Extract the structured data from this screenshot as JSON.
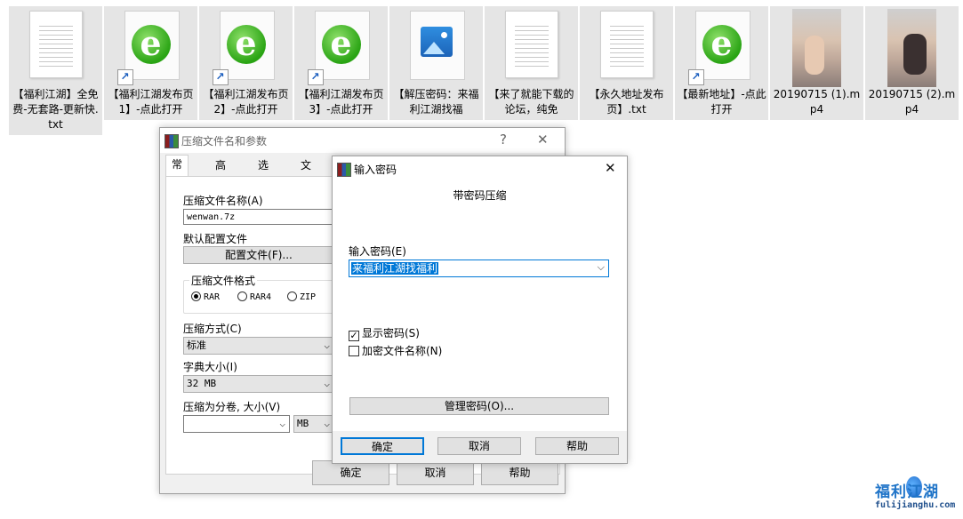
{
  "desktop": {
    "files": [
      {
        "label": "【福利江湖】全免费-无套路-更新快.txt",
        "kind": "text"
      },
      {
        "label": "【福利江湖发布页1】-点此打开",
        "kind": "ie-shortcut"
      },
      {
        "label": "【福利江湖发布页2】-点此打开",
        "kind": "ie-shortcut"
      },
      {
        "label": "【福利江湖发布页3】-点此打开",
        "kind": "ie-shortcut"
      },
      {
        "label": "【解压密码：来福利江湖找福",
        "kind": "image"
      },
      {
        "label": "【来了就能下载的论坛，纯免",
        "kind": "text"
      },
      {
        "label": "【永久地址发布页】.txt",
        "kind": "text"
      },
      {
        "label": "【最新地址】-点此打开",
        "kind": "ie-shortcut"
      },
      {
        "label": "20190715 (1).mp4",
        "kind": "video"
      },
      {
        "label": "20190715 (2).mp4",
        "kind": "video"
      }
    ]
  },
  "archive_dialog": {
    "title": "压缩文件名和参数",
    "help_glyph": "?",
    "close_glyph": "✕",
    "tabs": [
      "常规",
      "高级",
      "选项",
      "文件"
    ],
    "archive_name_label": "压缩文件名称(A)",
    "archive_name_value": "wenwan.7z",
    "default_profile_label": "默认配置文件",
    "profile_button": "配置文件(F)...",
    "format_group_label": "压缩文件格式",
    "formats": [
      "RAR",
      "RAR4",
      "ZIP"
    ],
    "selected_format": "RAR",
    "method_label": "压缩方式(C)",
    "method_value": "标准",
    "dict_label": "字典大小(I)",
    "dict_value": "32 MB",
    "split_label": "压缩为分卷, 大小(V)",
    "split_value": "",
    "split_unit": "MB",
    "ok": "确定",
    "cancel": "取消",
    "help": "帮助"
  },
  "password_dialog": {
    "title": "输入密码",
    "close_glyph": "✕",
    "heading": "带密码压缩",
    "input_label": "输入密码(E)",
    "password_value": "来福利江湖找福利",
    "show_password_label": "显示密码(S)",
    "show_password_checked": true,
    "encrypt_names_label": "加密文件名称(N)",
    "encrypt_names_checked": false,
    "manage_button": "管理密码(O)...",
    "ok": "确定",
    "cancel": "取消",
    "help": "帮助"
  },
  "watermark": {
    "title": "福利江湖",
    "url": "fulijianghu.com"
  },
  "colors": {
    "accent": "#0078d7",
    "selection_bg": "#e5e5e5",
    "ie_green": "#2aa414"
  }
}
